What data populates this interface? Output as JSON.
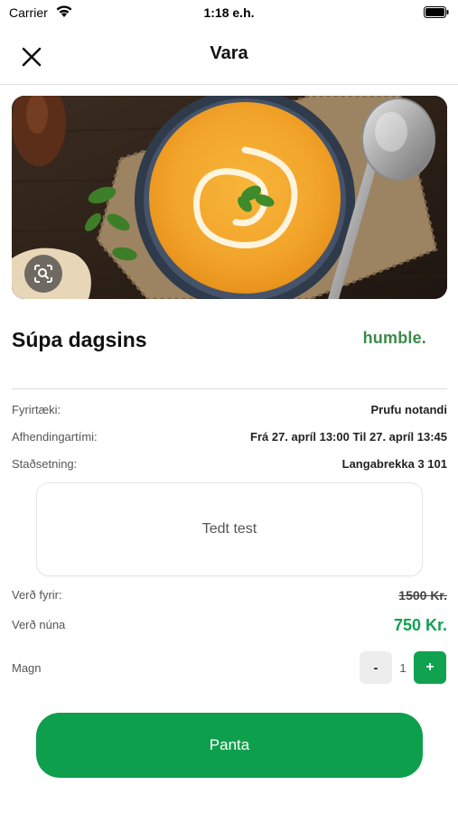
{
  "status_bar": {
    "carrier": "Carrier",
    "time": "1:18 e.h.",
    "wifi_icon": "wifi-icon",
    "battery_icon": "battery-icon"
  },
  "header": {
    "title": "Vara",
    "close_icon": "close-icon"
  },
  "product": {
    "image_icon": "zoom-scan-icon",
    "name": "Súpa dagsins",
    "brand": "humble."
  },
  "details": {
    "company_label": "Fyrirtæki:",
    "company_value": "Prufu notandi",
    "pickup_label": "Afhendingartími:",
    "pickup_value": "Frá 27. apríl 13:00 Til 27. apríl 13:45",
    "location_label": "Staðsetning:",
    "location_value": "Langabrekka 3 101",
    "note": "Tedt test"
  },
  "pricing": {
    "before_label": "Verð fyrir:",
    "before_value": "1500 Kr.",
    "now_label": "Verð núna",
    "now_value": "750 Kr."
  },
  "quantity": {
    "label": "Magn",
    "minus_label": "-",
    "value": "1",
    "plus_label": "+"
  },
  "order_button": {
    "label": "Panta"
  },
  "colors": {
    "accent": "#0e9f4d",
    "brand": "#3a8a4a"
  }
}
